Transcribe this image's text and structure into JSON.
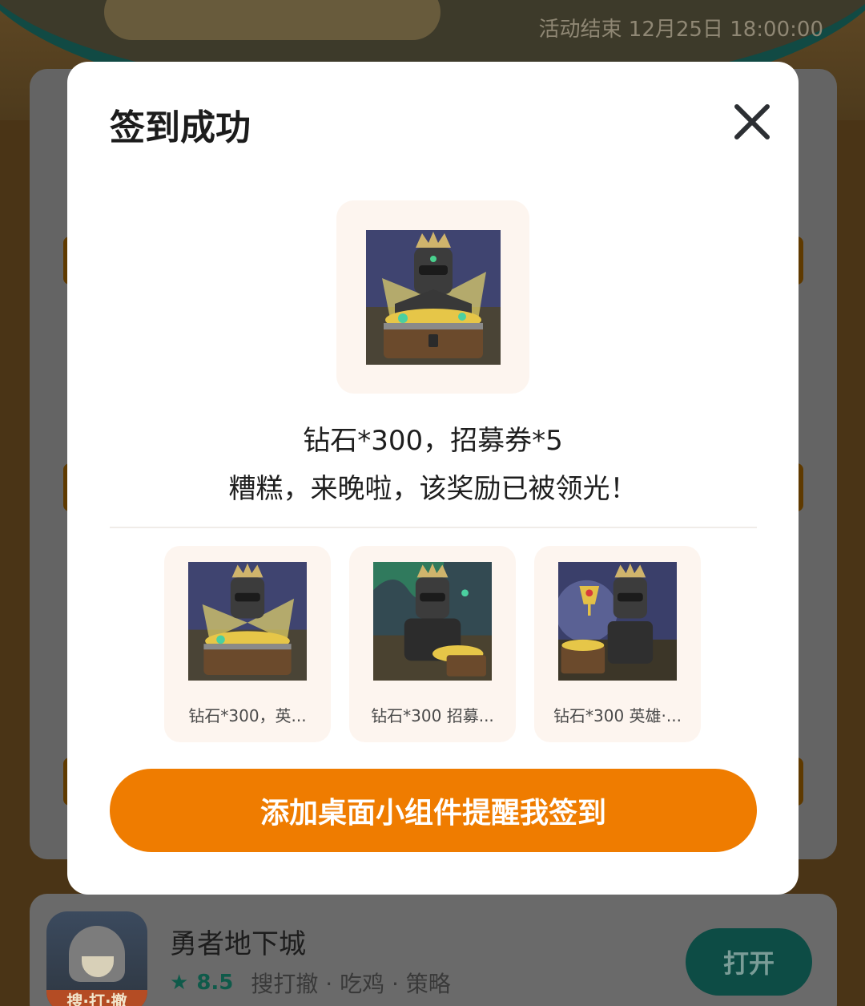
{
  "background": {
    "deadline": "活动结束 12月25日 18:00:00",
    "game": {
      "name": "勇者地下城",
      "icon_tag": "搜·打·撤",
      "rating": "8.5",
      "tags": "搜打撤 · 吃鸡 · 策略",
      "open_label": "打开"
    }
  },
  "modal": {
    "title": "签到成功",
    "close_icon": "close-icon",
    "main_reward": {
      "name": "钻石*300，招募券*5",
      "status": "糟糕，来晚啦，该奖励已被领光！"
    },
    "rewards": [
      {
        "caption": "钻石*300，英..."
      },
      {
        "caption": "钻石*300 招募..."
      },
      {
        "caption": "钻石*300 英雄·..."
      }
    ],
    "widget_button_label": "添加桌面小组件提醒我签到"
  },
  "colors": {
    "accent": "#ef7c00",
    "reward_bg": "#fdf5ef",
    "overlay": "#4a3416"
  }
}
